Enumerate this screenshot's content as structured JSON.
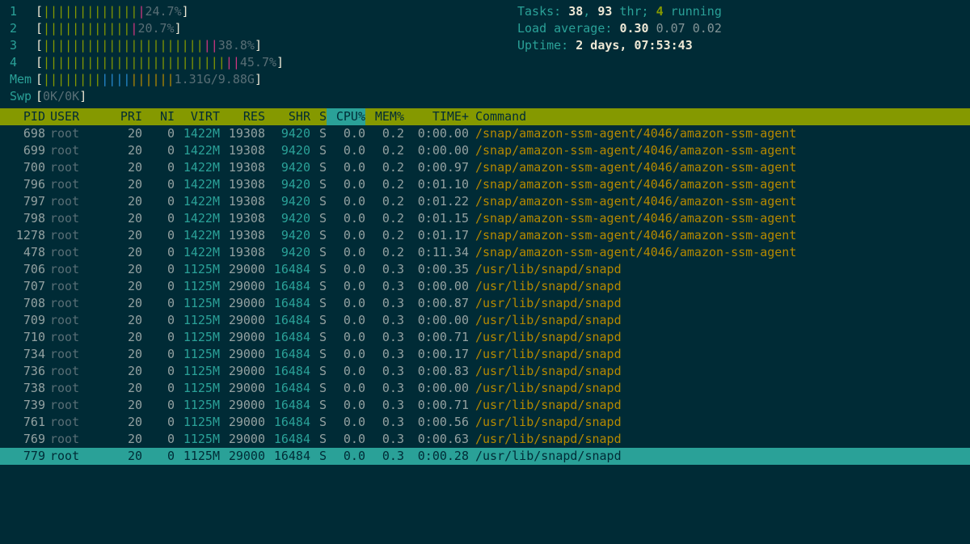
{
  "cpus": [
    {
      "label": "1",
      "pct": "24.7%",
      "green": 13,
      "red": 1
    },
    {
      "label": "2",
      "pct": "20.7%",
      "green": 12,
      "red": 1
    },
    {
      "label": "3",
      "pct": "38.8%",
      "green": 22,
      "red": 2
    },
    {
      "label": "4",
      "pct": "45.7%",
      "green": 25,
      "red": 2
    }
  ],
  "mem": {
    "label": "Mem",
    "used": "1.31G",
    "total": "9.88G",
    "green": 8,
    "blue": 4,
    "yellow": 6
  },
  "swp": {
    "label": "Swp",
    "used": "0K",
    "total": "0K"
  },
  "summary": {
    "tasks_label": "Tasks: ",
    "tasks": "38",
    "tasks_sep": ", ",
    "threads": "93",
    "thr_label": " thr; ",
    "running": "4",
    "running_label": " running",
    "load_label": "Load average: ",
    "load1": "0.30",
    "load5": "0.07",
    "load15": "0.02",
    "uptime_label": "Uptime: ",
    "uptime": "2 days, 07:53:43"
  },
  "columns": {
    "pid": "PID",
    "user": "USER",
    "pri": "PRI",
    "ni": "NI",
    "virt": "VIRT",
    "res": "RES",
    "shr": "SHR",
    "s": "S",
    "cpu": "CPU%",
    "mem": "MEM%",
    "time": "TIME+",
    "cmd": "Command"
  },
  "processes": [
    {
      "pid": "698",
      "user": "root",
      "pri": "20",
      "ni": "0",
      "virt": "1422M",
      "res": "19308",
      "shr": "9420",
      "s": "S",
      "cpu": "0.0",
      "mem": "0.2",
      "time": "0:00.00",
      "cmd": "/snap/amazon-ssm-agent/4046/amazon-ssm-agent"
    },
    {
      "pid": "699",
      "user": "root",
      "pri": "20",
      "ni": "0",
      "virt": "1422M",
      "res": "19308",
      "shr": "9420",
      "s": "S",
      "cpu": "0.0",
      "mem": "0.2",
      "time": "0:00.00",
      "cmd": "/snap/amazon-ssm-agent/4046/amazon-ssm-agent"
    },
    {
      "pid": "700",
      "user": "root",
      "pri": "20",
      "ni": "0",
      "virt": "1422M",
      "res": "19308",
      "shr": "9420",
      "s": "S",
      "cpu": "0.0",
      "mem": "0.2",
      "time": "0:00.97",
      "cmd": "/snap/amazon-ssm-agent/4046/amazon-ssm-agent"
    },
    {
      "pid": "796",
      "user": "root",
      "pri": "20",
      "ni": "0",
      "virt": "1422M",
      "res": "19308",
      "shr": "9420",
      "s": "S",
      "cpu": "0.0",
      "mem": "0.2",
      "time": "0:01.10",
      "cmd": "/snap/amazon-ssm-agent/4046/amazon-ssm-agent"
    },
    {
      "pid": "797",
      "user": "root",
      "pri": "20",
      "ni": "0",
      "virt": "1422M",
      "res": "19308",
      "shr": "9420",
      "s": "S",
      "cpu": "0.0",
      "mem": "0.2",
      "time": "0:01.22",
      "cmd": "/snap/amazon-ssm-agent/4046/amazon-ssm-agent"
    },
    {
      "pid": "798",
      "user": "root",
      "pri": "20",
      "ni": "0",
      "virt": "1422M",
      "res": "19308",
      "shr": "9420",
      "s": "S",
      "cpu": "0.0",
      "mem": "0.2",
      "time": "0:01.15",
      "cmd": "/snap/amazon-ssm-agent/4046/amazon-ssm-agent"
    },
    {
      "pid": "1278",
      "user": "root",
      "pri": "20",
      "ni": "0",
      "virt": "1422M",
      "res": "19308",
      "shr": "9420",
      "s": "S",
      "cpu": "0.0",
      "mem": "0.2",
      "time": "0:01.17",
      "cmd": "/snap/amazon-ssm-agent/4046/amazon-ssm-agent"
    },
    {
      "pid": "478",
      "user": "root",
      "pri": "20",
      "ni": "0",
      "virt": "1422M",
      "res": "19308",
      "shr": "9420",
      "s": "S",
      "cpu": "0.0",
      "mem": "0.2",
      "time": "0:11.34",
      "cmd": "/snap/amazon-ssm-agent/4046/amazon-ssm-agent"
    },
    {
      "pid": "706",
      "user": "root",
      "pri": "20",
      "ni": "0",
      "virt": "1125M",
      "res": "29000",
      "shr": "16484",
      "s": "S",
      "cpu": "0.0",
      "mem": "0.3",
      "time": "0:00.35",
      "cmd": "/usr/lib/snapd/snapd"
    },
    {
      "pid": "707",
      "user": "root",
      "pri": "20",
      "ni": "0",
      "virt": "1125M",
      "res": "29000",
      "shr": "16484",
      "s": "S",
      "cpu": "0.0",
      "mem": "0.3",
      "time": "0:00.00",
      "cmd": "/usr/lib/snapd/snapd"
    },
    {
      "pid": "708",
      "user": "root",
      "pri": "20",
      "ni": "0",
      "virt": "1125M",
      "res": "29000",
      "shr": "16484",
      "s": "S",
      "cpu": "0.0",
      "mem": "0.3",
      "time": "0:00.87",
      "cmd": "/usr/lib/snapd/snapd"
    },
    {
      "pid": "709",
      "user": "root",
      "pri": "20",
      "ni": "0",
      "virt": "1125M",
      "res": "29000",
      "shr": "16484",
      "s": "S",
      "cpu": "0.0",
      "mem": "0.3",
      "time": "0:00.00",
      "cmd": "/usr/lib/snapd/snapd"
    },
    {
      "pid": "710",
      "user": "root",
      "pri": "20",
      "ni": "0",
      "virt": "1125M",
      "res": "29000",
      "shr": "16484",
      "s": "S",
      "cpu": "0.0",
      "mem": "0.3",
      "time": "0:00.71",
      "cmd": "/usr/lib/snapd/snapd"
    },
    {
      "pid": "734",
      "user": "root",
      "pri": "20",
      "ni": "0",
      "virt": "1125M",
      "res": "29000",
      "shr": "16484",
      "s": "S",
      "cpu": "0.0",
      "mem": "0.3",
      "time": "0:00.17",
      "cmd": "/usr/lib/snapd/snapd"
    },
    {
      "pid": "736",
      "user": "root",
      "pri": "20",
      "ni": "0",
      "virt": "1125M",
      "res": "29000",
      "shr": "16484",
      "s": "S",
      "cpu": "0.0",
      "mem": "0.3",
      "time": "0:00.83",
      "cmd": "/usr/lib/snapd/snapd"
    },
    {
      "pid": "738",
      "user": "root",
      "pri": "20",
      "ni": "0",
      "virt": "1125M",
      "res": "29000",
      "shr": "16484",
      "s": "S",
      "cpu": "0.0",
      "mem": "0.3",
      "time": "0:00.00",
      "cmd": "/usr/lib/snapd/snapd"
    },
    {
      "pid": "739",
      "user": "root",
      "pri": "20",
      "ni": "0",
      "virt": "1125M",
      "res": "29000",
      "shr": "16484",
      "s": "S",
      "cpu": "0.0",
      "mem": "0.3",
      "time": "0:00.71",
      "cmd": "/usr/lib/snapd/snapd"
    },
    {
      "pid": "761",
      "user": "root",
      "pri": "20",
      "ni": "0",
      "virt": "1125M",
      "res": "29000",
      "shr": "16484",
      "s": "S",
      "cpu": "0.0",
      "mem": "0.3",
      "time": "0:00.56",
      "cmd": "/usr/lib/snapd/snapd"
    },
    {
      "pid": "769",
      "user": "root",
      "pri": "20",
      "ni": "0",
      "virt": "1125M",
      "res": "29000",
      "shr": "16484",
      "s": "S",
      "cpu": "0.0",
      "mem": "0.3",
      "time": "0:00.63",
      "cmd": "/usr/lib/snapd/snapd"
    },
    {
      "pid": "779",
      "user": "root",
      "pri": "20",
      "ni": "0",
      "virt": "1125M",
      "res": "29000",
      "shr": "16484",
      "s": "S",
      "cpu": "0.0",
      "mem": "0.3",
      "time": "0:00.28",
      "cmd": "/usr/lib/snapd/snapd",
      "selected": true
    }
  ]
}
